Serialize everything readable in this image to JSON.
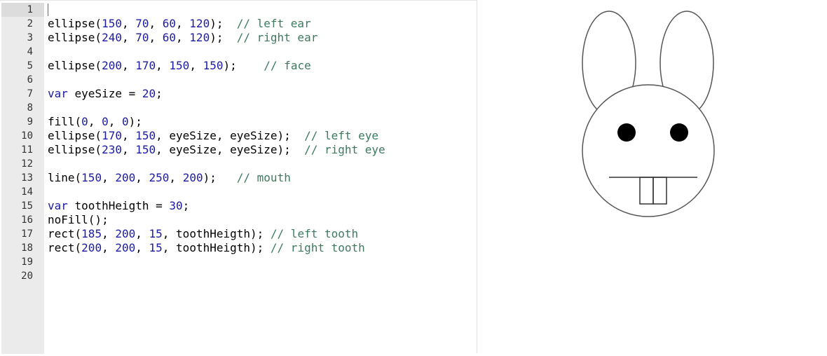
{
  "editor": {
    "lines": [
      {
        "n": "1",
        "tokens": []
      },
      {
        "n": "2",
        "tokens": [
          [
            "f",
            "ellipse("
          ],
          [
            "num",
            "150"
          ],
          [
            "p",
            ", "
          ],
          [
            "num",
            "70"
          ],
          [
            "p",
            ", "
          ],
          [
            "num",
            "60"
          ],
          [
            "p",
            ", "
          ],
          [
            "num",
            "120"
          ],
          [
            "p",
            ");  "
          ],
          [
            "cm",
            "// left ear"
          ]
        ]
      },
      {
        "n": "3",
        "tokens": [
          [
            "f",
            "ellipse("
          ],
          [
            "num",
            "240"
          ],
          [
            "p",
            ", "
          ],
          [
            "num",
            "70"
          ],
          [
            "p",
            ", "
          ],
          [
            "num",
            "60"
          ],
          [
            "p",
            ", "
          ],
          [
            "num",
            "120"
          ],
          [
            "p",
            ");  "
          ],
          [
            "cm",
            "// right ear"
          ]
        ]
      },
      {
        "n": "4",
        "tokens": []
      },
      {
        "n": "5",
        "tokens": [
          [
            "f",
            "ellipse("
          ],
          [
            "num",
            "200"
          ],
          [
            "p",
            ", "
          ],
          [
            "num",
            "170"
          ],
          [
            "p",
            ", "
          ],
          [
            "num",
            "150"
          ],
          [
            "p",
            ", "
          ],
          [
            "num",
            "150"
          ],
          [
            "p",
            ");    "
          ],
          [
            "cm",
            "// face"
          ]
        ]
      },
      {
        "n": "6",
        "tokens": []
      },
      {
        "n": "7",
        "tokens": [
          [
            "kw",
            "var"
          ],
          [
            "p",
            " eyeSize = "
          ],
          [
            "num",
            "20"
          ],
          [
            "p",
            ";"
          ]
        ]
      },
      {
        "n": "8",
        "tokens": []
      },
      {
        "n": "9",
        "tokens": [
          [
            "f",
            "fill("
          ],
          [
            "num",
            "0"
          ],
          [
            "p",
            ", "
          ],
          [
            "num",
            "0"
          ],
          [
            "p",
            ", "
          ],
          [
            "num",
            "0"
          ],
          [
            "p",
            ");"
          ]
        ]
      },
      {
        "n": "10",
        "tokens": [
          [
            "f",
            "ellipse("
          ],
          [
            "num",
            "170"
          ],
          [
            "p",
            ", "
          ],
          [
            "num",
            "150"
          ],
          [
            "p",
            ", eyeSize, eyeSize);  "
          ],
          [
            "cm",
            "// left eye"
          ]
        ]
      },
      {
        "n": "11",
        "tokens": [
          [
            "f",
            "ellipse("
          ],
          [
            "num",
            "230"
          ],
          [
            "p",
            ", "
          ],
          [
            "num",
            "150"
          ],
          [
            "p",
            ", eyeSize, eyeSize);  "
          ],
          [
            "cm",
            "// right eye"
          ]
        ]
      },
      {
        "n": "12",
        "tokens": []
      },
      {
        "n": "13",
        "tokens": [
          [
            "f",
            "line("
          ],
          [
            "num",
            "150"
          ],
          [
            "p",
            ", "
          ],
          [
            "num",
            "200"
          ],
          [
            "p",
            ", "
          ],
          [
            "num",
            "250"
          ],
          [
            "p",
            ", "
          ],
          [
            "num",
            "200"
          ],
          [
            "p",
            ");   "
          ],
          [
            "cm",
            "// mouth"
          ]
        ]
      },
      {
        "n": "14",
        "tokens": []
      },
      {
        "n": "15",
        "tokens": [
          [
            "kw",
            "var"
          ],
          [
            "p",
            " toothHeigth = "
          ],
          [
            "num",
            "30"
          ],
          [
            "p",
            ";"
          ]
        ]
      },
      {
        "n": "16",
        "tokens": [
          [
            "f",
            "noFill();"
          ]
        ]
      },
      {
        "n": "17",
        "tokens": [
          [
            "f",
            "rect("
          ],
          [
            "num",
            "185"
          ],
          [
            "p",
            ", "
          ],
          [
            "num",
            "200"
          ],
          [
            "p",
            ", "
          ],
          [
            "num",
            "15"
          ],
          [
            "p",
            ", toothHeigth); "
          ],
          [
            "cm",
            "// left tooth"
          ]
        ]
      },
      {
        "n": "18",
        "tokens": [
          [
            "f",
            "rect("
          ],
          [
            "num",
            "200"
          ],
          [
            "p",
            ", "
          ],
          [
            "num",
            "200"
          ],
          [
            "p",
            ", "
          ],
          [
            "num",
            "15"
          ],
          [
            "p",
            ", toothHeigth); "
          ],
          [
            "cm",
            "// right tooth"
          ]
        ]
      },
      {
        "n": "19",
        "tokens": []
      },
      {
        "n": "20",
        "tokens": []
      }
    ]
  },
  "colors": {
    "number": "#1a1aa6",
    "keyword": "#1a1aa6",
    "comment": "#3d7a5e",
    "stroke": "#555555"
  }
}
